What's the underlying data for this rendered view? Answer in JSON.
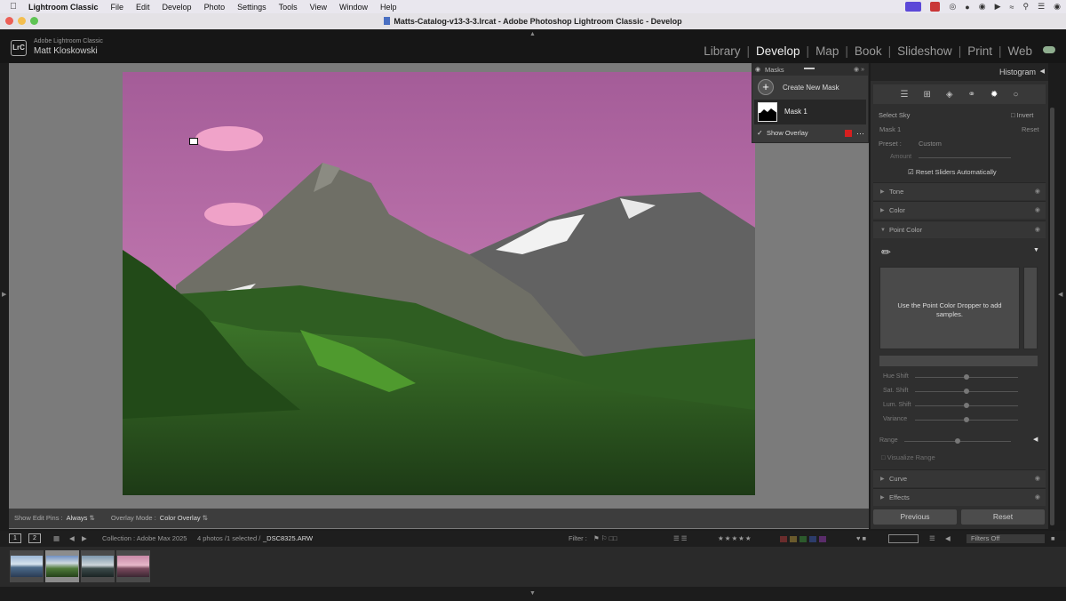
{
  "menubar": {
    "app_name": "Lightroom Classic",
    "items": [
      "File",
      "Edit",
      "Develop",
      "Photo",
      "Settings",
      "Tools",
      "View",
      "Window",
      "Help"
    ]
  },
  "window": {
    "title": "Matts-Catalog-v13-3-3.lrcat - Adobe Photoshop Lightroom Classic - Develop"
  },
  "identity": {
    "badge": "LrC",
    "app_name": "Adobe Lightroom Classic",
    "user": "Matt Kloskowski"
  },
  "modules": {
    "items": [
      "Library",
      "Develop",
      "Map",
      "Book",
      "Slideshow",
      "Print",
      "Web"
    ],
    "active": "Develop"
  },
  "masks_panel": {
    "title": "Masks",
    "create_label": "Create New Mask",
    "mask_name": "Mask 1",
    "show_overlay_label": "Show Overlay",
    "overlay_color": "#d61f1f"
  },
  "edit_toolbar": {
    "show_pins_label": "Show Edit Pins :",
    "show_pins_value": "Always",
    "overlay_mode_label": "Overlay Mode :",
    "overlay_mode_value": "Color Overlay"
  },
  "right_panel": {
    "histogram_label": "Histogram",
    "select_label": "Select Sky",
    "invert_label": "Invert",
    "mask_label": "Mask 1",
    "reset_label": "Reset",
    "preset_label": "Preset :",
    "preset_value": "Custom",
    "amount_label": "Amount",
    "reset_sliders_label": "Reset Sliders Automatically",
    "sections": {
      "tone": "Tone",
      "color": "Color",
      "point_color": "Point Color",
      "curve": "Curve",
      "effects": "Effects"
    },
    "dropper_hint": "Use the Point Color Dropper to add samples.",
    "sliders": {
      "hue_shift": "Hue Shift",
      "sat_shift": "Sat. Shift",
      "lum_shift": "Lum. Shift",
      "variance": "Variance",
      "range": "Range"
    },
    "visualize_range_label": "Visualize Range",
    "previous_label": "Previous",
    "reset_button_label": "Reset"
  },
  "filmstrip_bar": {
    "page1": "1",
    "page2": "2",
    "collection": "Collection : Adobe Max 2025",
    "selection": "4 photos /1 selected /",
    "filename": "_DSC8325.ARW",
    "filter_label": "Filter :",
    "filters_off": "Filters Off"
  }
}
